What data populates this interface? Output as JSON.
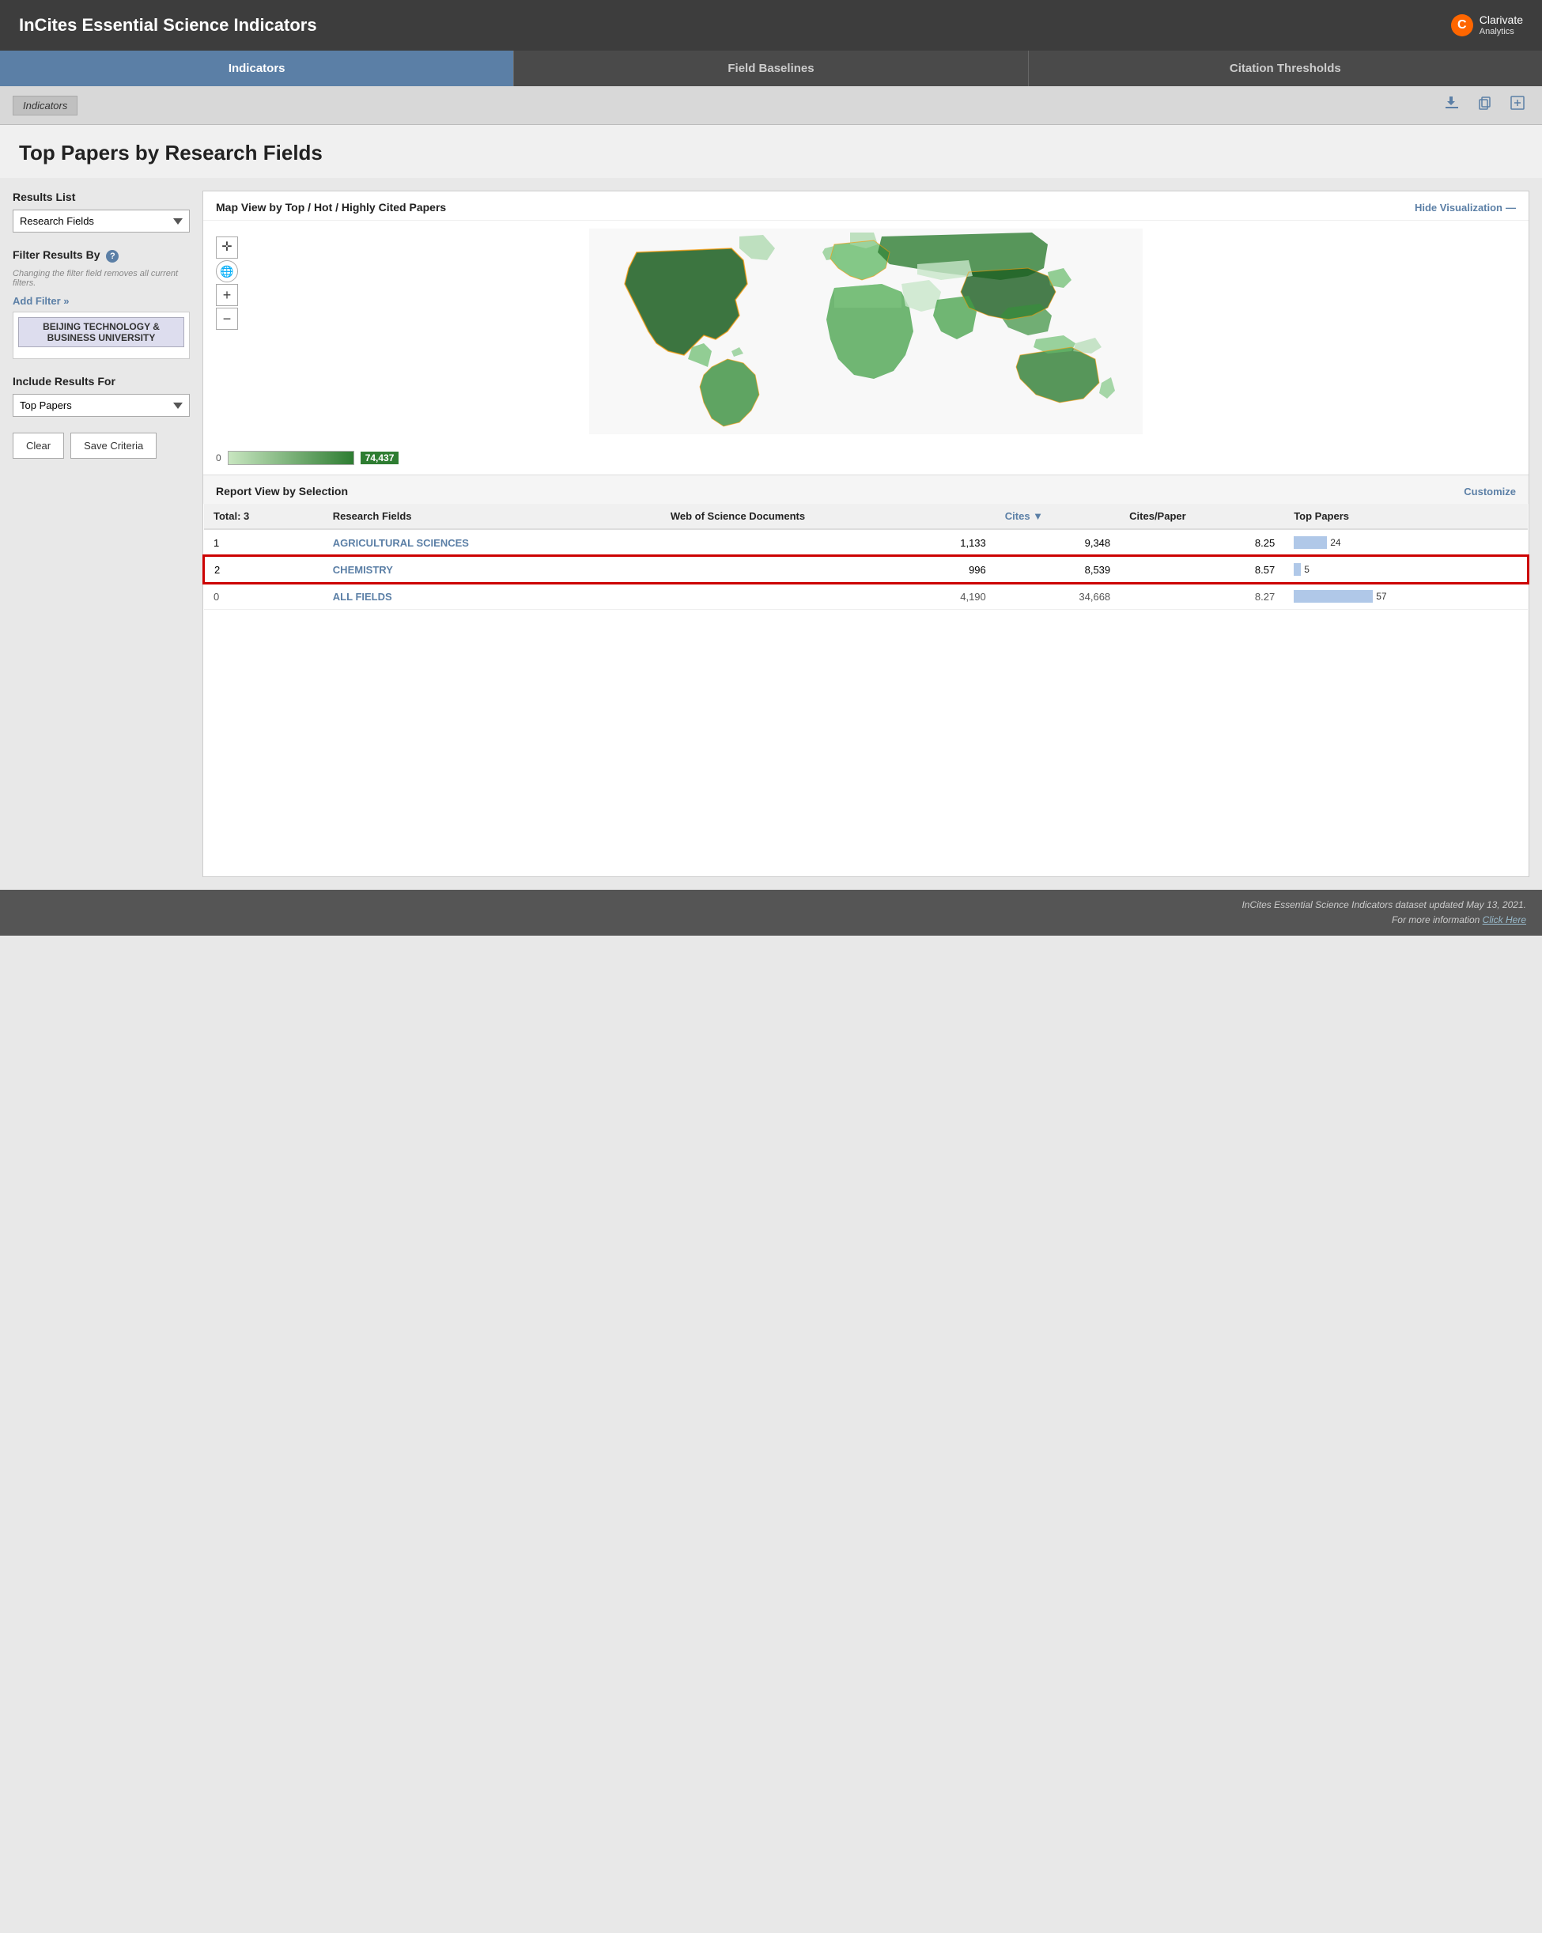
{
  "header": {
    "title": "InCites Essential Science Indicators",
    "logo_text": "Clarivate",
    "logo_sub": "Analytics"
  },
  "nav": {
    "tabs": [
      {
        "label": "Indicators",
        "active": true
      },
      {
        "label": "Field Baselines",
        "active": false
      },
      {
        "label": "Citation Thresholds",
        "active": false
      }
    ]
  },
  "toolbar": {
    "breadcrumb": "Indicators",
    "icons": [
      "download-icon",
      "copy-icon",
      "add-icon"
    ]
  },
  "page": {
    "title": "Top Papers by Research Fields"
  },
  "sidebar": {
    "results_list_label": "Results List",
    "results_list_value": "Research Fields",
    "filter_results_label": "Filter Results By",
    "filter_note": "Changing the filter field removes all current filters.",
    "add_filter_label": "Add Filter »",
    "filter_tag": "BEIJING TECHNOLOGY & BUSINESS UNIVERSITY",
    "include_results_label": "Include Results For",
    "include_results_value": "Top Papers",
    "clear_btn": "Clear",
    "save_btn": "Save Criteria"
  },
  "map": {
    "title": "Map View by Top / Hot / Highly Cited Papers",
    "hide_viz_label": "Hide Visualization",
    "legend_min": "0",
    "legend_value": "74,437",
    "controls": {
      "pan": "✛",
      "globe": "🌐",
      "zoom_in": "+",
      "zoom_out": "−"
    }
  },
  "report": {
    "title": "Report View by Selection",
    "customize_label": "Customize",
    "columns": [
      {
        "label": "Total: 3",
        "sub": ""
      },
      {
        "label": "Research Fields",
        "sub": ""
      },
      {
        "label": "Web of Science Documents",
        "sub": ""
      },
      {
        "label": "Cites ▼",
        "sub": "",
        "sortable": true
      },
      {
        "label": "Cites/Paper",
        "sub": ""
      },
      {
        "label": "Top Papers",
        "sub": ""
      }
    ],
    "rows": [
      {
        "rank": "1",
        "field": "AGRICULTURAL SCIENCES",
        "wos_docs": "1,133",
        "cites": "9,348",
        "cites_per_paper": "8.25",
        "top_papers": 24,
        "top_papers_max": 57,
        "highlighted": false
      },
      {
        "rank": "2",
        "field": "CHEMISTRY",
        "wos_docs": "996",
        "cites": "8,539",
        "cites_per_paper": "8.57",
        "top_papers": 5,
        "top_papers_max": 57,
        "highlighted": true
      },
      {
        "rank": "0",
        "field": "ALL FIELDS",
        "wos_docs": "4,190",
        "cites": "34,668",
        "cites_per_paper": "8.27",
        "top_papers": 57,
        "top_papers_max": 57,
        "highlighted": false,
        "is_total": true
      }
    ]
  },
  "footer": {
    "line1": "InCites Essential Science Indicators dataset updated May 13, 2021.",
    "line2": "For more information ",
    "link_text": "Click Here",
    "link_url": "#"
  }
}
